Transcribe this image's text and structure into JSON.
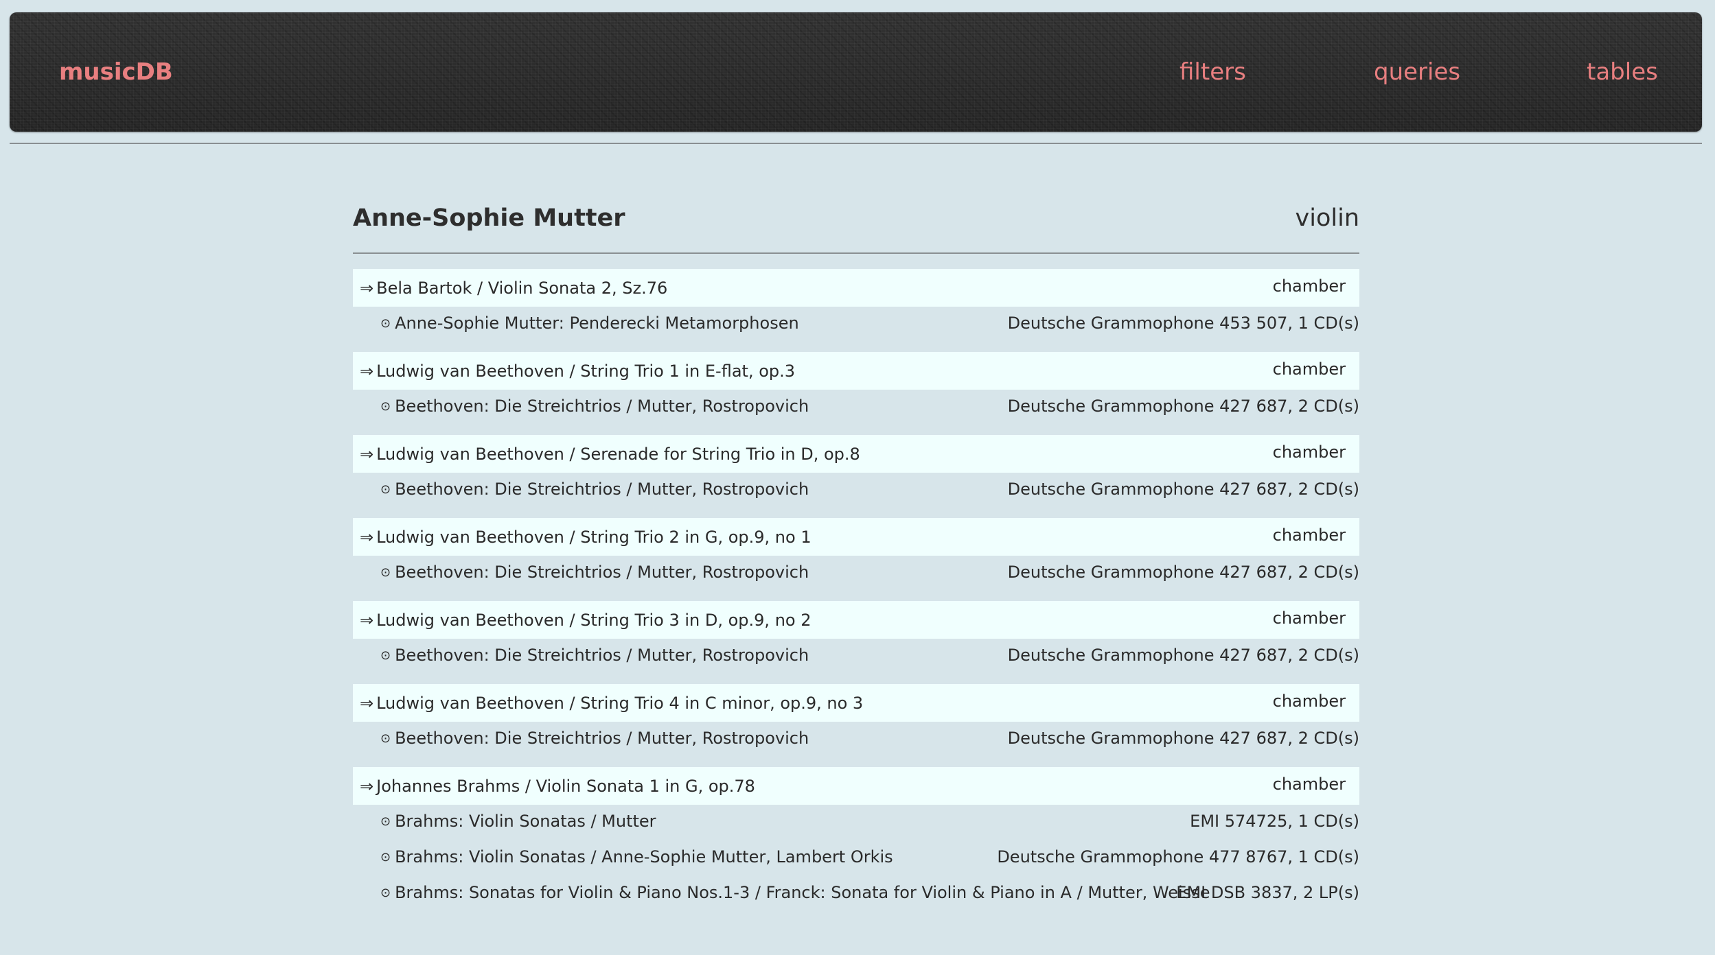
{
  "nav": {
    "brand": "musicDB",
    "links": [
      "filters",
      "queries",
      "tables"
    ],
    "link_color": "#e87f80"
  },
  "artist": {
    "name": "Anne-Sophie Mutter",
    "instrument": "violin"
  },
  "icons": {
    "work_arrow": "⇒",
    "recording_bullet": "⊙"
  },
  "works": [
    {
      "title": "Bela Bartok / Violin Sonata 2, Sz.76",
      "genre": "chamber",
      "recordings": [
        {
          "title": "Anne-Sophie Mutter: Penderecki Metamorphosen",
          "label": "Deutsche Grammophone 453 507, 1 CD(s)"
        }
      ]
    },
    {
      "title": "Ludwig van Beethoven / String Trio 1 in E-flat, op.3",
      "genre": "chamber",
      "recordings": [
        {
          "title": "Beethoven: Die Streichtrios / Mutter, Rostropovich",
          "label": "Deutsche Grammophone 427 687, 2 CD(s)"
        }
      ]
    },
    {
      "title": "Ludwig van Beethoven / Serenade for String Trio in D, op.8",
      "genre": "chamber",
      "recordings": [
        {
          "title": "Beethoven: Die Streichtrios / Mutter, Rostropovich",
          "label": "Deutsche Grammophone 427 687, 2 CD(s)"
        }
      ]
    },
    {
      "title": "Ludwig van Beethoven / String Trio 2 in G, op.9, no 1",
      "genre": "chamber",
      "recordings": [
        {
          "title": "Beethoven: Die Streichtrios / Mutter, Rostropovich",
          "label": "Deutsche Grammophone 427 687, 2 CD(s)"
        }
      ]
    },
    {
      "title": "Ludwig van Beethoven / String Trio 3 in D, op.9, no 2",
      "genre": "chamber",
      "recordings": [
        {
          "title": "Beethoven: Die Streichtrios / Mutter, Rostropovich",
          "label": "Deutsche Grammophone 427 687, 2 CD(s)"
        }
      ]
    },
    {
      "title": "Ludwig van Beethoven / String Trio 4 in C minor, op.9, no 3",
      "genre": "chamber",
      "recordings": [
        {
          "title": "Beethoven: Die Streichtrios / Mutter, Rostropovich",
          "label": "Deutsche Grammophone 427 687, 2 CD(s)"
        }
      ]
    },
    {
      "title": "Johannes Brahms / Violin Sonata 1 in G, op.78",
      "genre": "chamber",
      "recordings": [
        {
          "title": "Brahms: Violin Sonatas / Mutter",
          "label": "EMI 574725, 1 CD(s)"
        },
        {
          "title": "Brahms: Violin Sonatas / Anne-Sophie Mutter, Lambert Orkis",
          "label": "Deutsche Grammophone 477 8767, 1 CD(s)"
        },
        {
          "title": "Brahms: Sonatas for Violin & Piano Nos.1-3 / Franck: Sonata for Violin & Piano in A / Mutter, Weisse",
          "label": "EMI DSB 3837, 2 LP(s)"
        }
      ]
    }
  ]
}
